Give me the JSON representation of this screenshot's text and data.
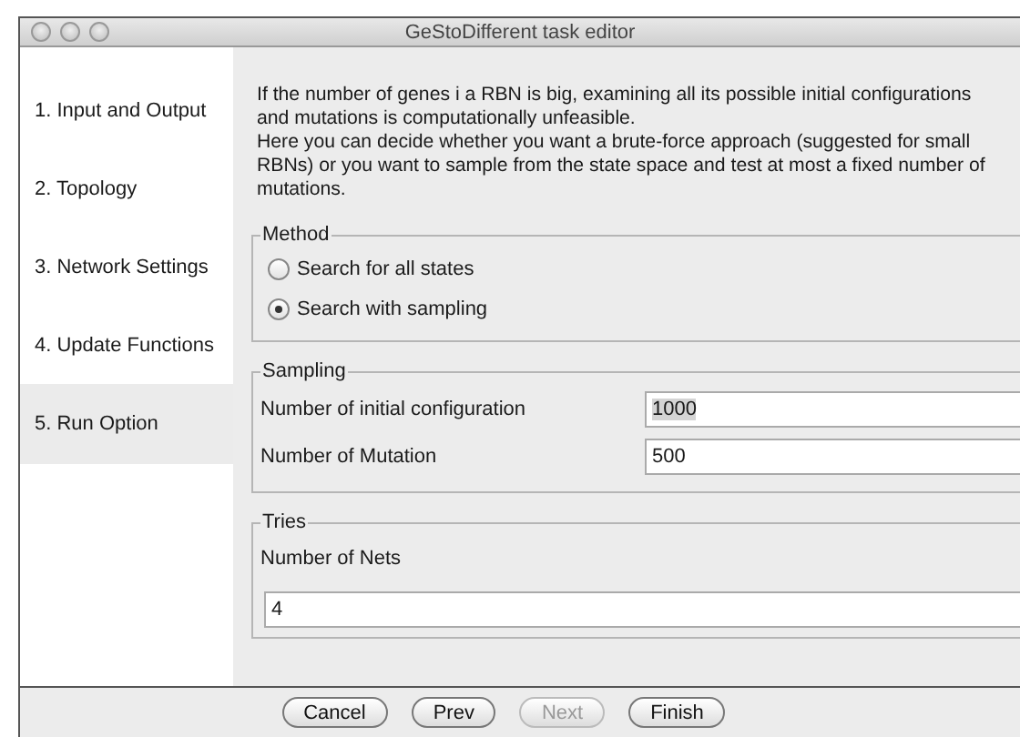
{
  "window": {
    "title": "GeStoDifferent task editor"
  },
  "steps": [
    {
      "label": "1. Input and Output",
      "selected": false
    },
    {
      "label": "2. Topology",
      "selected": false
    },
    {
      "label": "3. Network Settings",
      "selected": false
    },
    {
      "label": "4. Update Functions",
      "selected": false
    },
    {
      "label": "5. Run Option",
      "selected": true
    }
  ],
  "intro": [
    "If the number of genes i a RBN is big, examining all its possible initial configurations and mutations is computationally unfeasible.",
    "Here you can decide whether you want a brute-force approach (suggested for small RBNs) or you want to sample from the state space and test at most a fixed number of mutations."
  ],
  "method": {
    "legend": "Method",
    "options": [
      {
        "label": "Search for all states",
        "selected": false
      },
      {
        "label": "Search with sampling",
        "selected": true
      }
    ]
  },
  "sampling": {
    "legend": "Sampling",
    "fields": [
      {
        "label": "Number of initial configuration",
        "value": "1000",
        "text_selected": true
      },
      {
        "label": "Number of Mutation",
        "value": "500",
        "text_selected": false
      }
    ]
  },
  "tries": {
    "legend": "Tries",
    "label": "Number of Nets",
    "value": "4"
  },
  "buttons": [
    {
      "label": "Cancel",
      "disabled": false
    },
    {
      "label": "Prev",
      "disabled": false
    },
    {
      "label": "Next",
      "disabled": true
    },
    {
      "label": "Finish",
      "disabled": false
    }
  ]
}
